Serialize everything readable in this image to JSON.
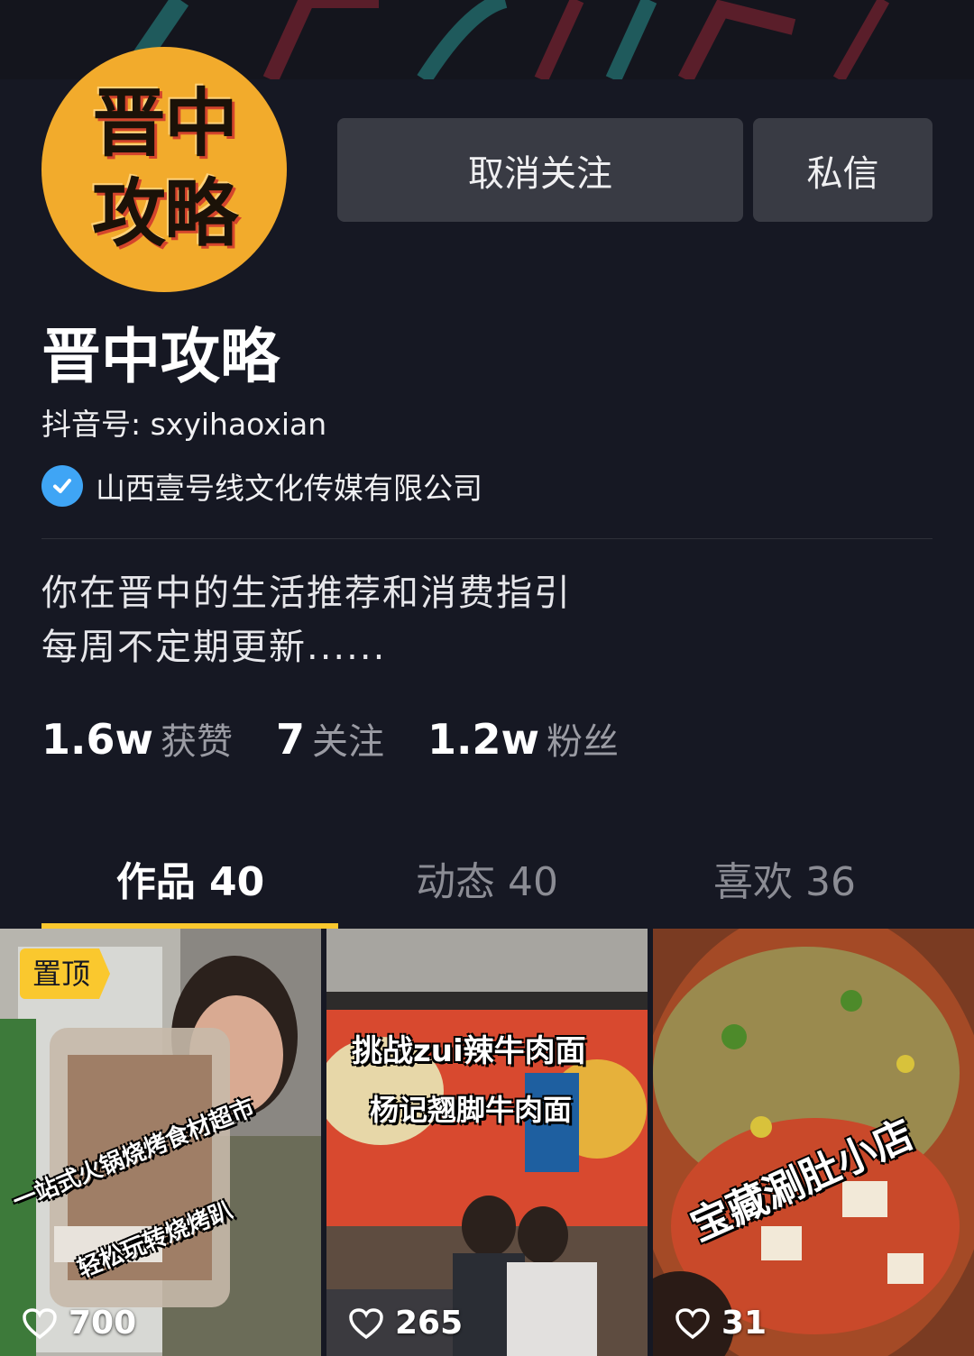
{
  "avatar": {
    "line1": "晋中",
    "line2": "攻略"
  },
  "actions": {
    "unfollow_label": "取消关注",
    "message_label": "私信"
  },
  "profile": {
    "name": "晋中攻略",
    "douyin_id": "抖音号: sxyihaoxian",
    "verified_org": "山西壹号线文化传媒有限公司",
    "bio_line1": "你在晋中的生活推荐和消费指引",
    "bio_line2": "每周不定期更新......"
  },
  "stats": [
    {
      "value": "1.6w",
      "label": "获赞"
    },
    {
      "value": "7",
      "label": "关注"
    },
    {
      "value": "1.2w",
      "label": "粉丝"
    }
  ],
  "tabs": [
    {
      "label": "作品 40",
      "active": true
    },
    {
      "label": "动态 40",
      "active": false
    },
    {
      "label": "喜欢 36",
      "active": false
    }
  ],
  "videos": [
    {
      "pinned_label": "置顶",
      "caption1": "一站式火锅烧烤食材超市",
      "caption2": "轻松玩转烧烤趴",
      "likes": "700"
    },
    {
      "caption1": "挑战zui辣牛肉面",
      "caption2": "杨记翘脚牛肉面",
      "likes": "265"
    },
    {
      "caption1": "宝藏涮肚小店",
      "likes": "31"
    }
  ],
  "colors": {
    "background": "#161823",
    "button": "#393b44",
    "tab_indicator": "#fac82e",
    "verified_badge": "#3fa5f5",
    "avatar_bg": "#f2ab2c"
  },
  "icons": [
    "verified-check-icon",
    "heart-icon",
    "pin-badge"
  ]
}
